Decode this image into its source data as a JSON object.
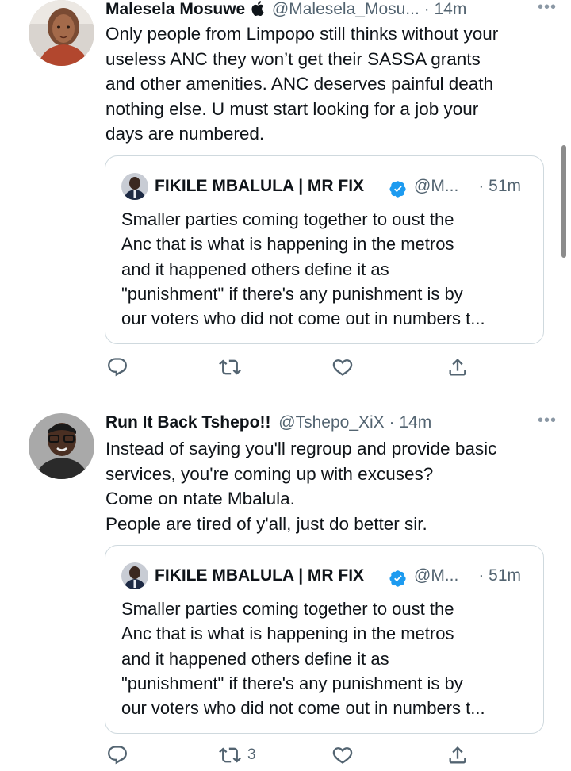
{
  "tweets": [
    {
      "name": "Malesela Mosuwe",
      "handle": "@Malesela_Mosu...",
      "time": "· 14m",
      "more": "•••",
      "body": [
        "Only people from Limpopo still thinks without your",
        "useless ANC they won’t get their SASSA grants",
        "and other amenities. ANC deserves painful death",
        "nothing else. U must start looking for a job your",
        "days are numbered."
      ],
      "quote": {
        "name": "FIKILE MBALULA | MR FIX",
        "handle": "@M...",
        "time": "· 51m",
        "body": [
          "Smaller parties coming together to oust the",
          "Anc that is what is happening in the metros",
          "and it happened others define it as",
          "\"punishment\" if there's any punishment is by",
          "our voters who did not come out in numbers t..."
        ]
      },
      "retweet_count": ""
    },
    {
      "name": "Run It Back Tshepo!!",
      "handle": "@Tshepo_XiX",
      "time": "· 14m",
      "more": "•••",
      "body": [
        "Instead of saying you'll regroup and provide basic",
        "services, you're coming up with excuses?",
        "Come on ntate Mbalula.",
        "People are tired of y'all, just do better sir."
      ],
      "quote": {
        "name": "FIKILE MBALULA | MR FIX",
        "handle": "@M...",
        "time": "· 51m",
        "body": [
          "Smaller parties coming together to oust the",
          "Anc that is what is happening in the metros",
          "and it happened others define it as",
          "\"punishment\" if there's any punishment is by",
          "our voters who did not come out in numbers t..."
        ]
      },
      "retweet_count": "3"
    }
  ],
  "icons": [
    "reply-icon",
    "retweet-icon",
    "like-icon",
    "share-icon",
    "apple-icon",
    "verified-icon"
  ],
  "colors": {
    "text": "#0f1419",
    "secondary": "#536471",
    "border": "#cfd9de",
    "verified": "#1d9bf0"
  }
}
